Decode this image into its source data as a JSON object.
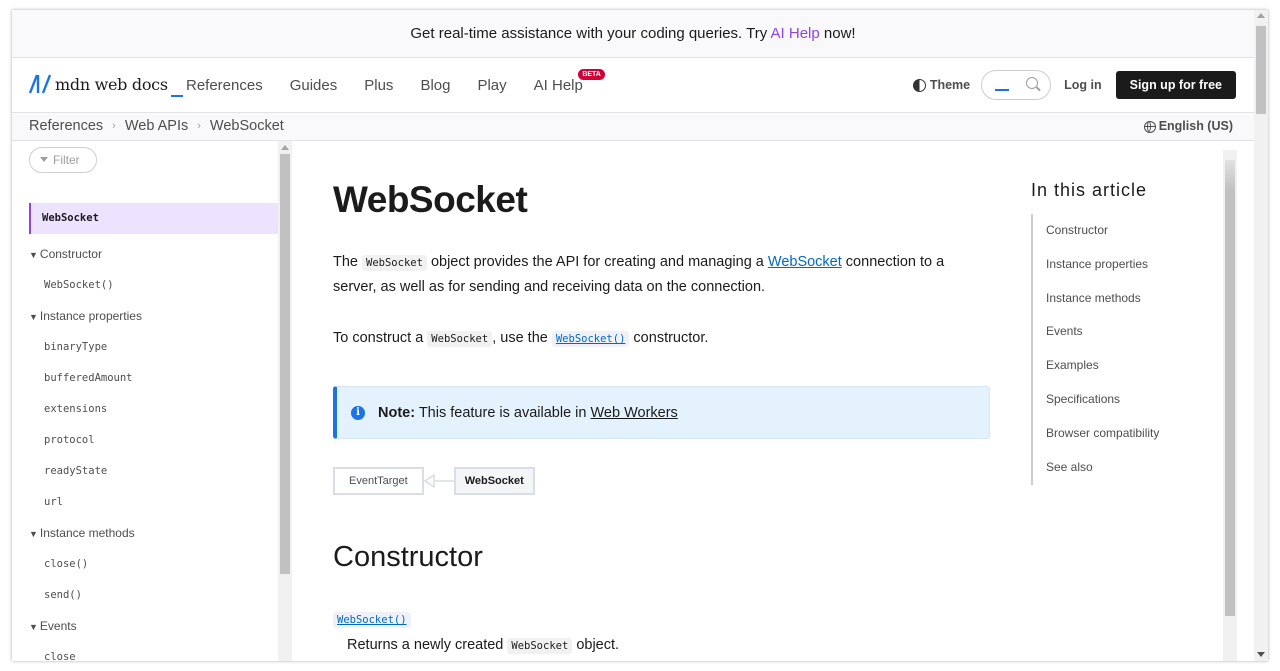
{
  "banner": {
    "prefix": "Get real-time assistance with your coding queries. Try ",
    "link": "AI Help",
    "suffix": " now!"
  },
  "header": {
    "logo_text": "mdn web docs",
    "nav": [
      {
        "label": "References"
      },
      {
        "label": "Guides"
      },
      {
        "label": "Plus"
      },
      {
        "label": "Blog"
      },
      {
        "label": "Play"
      },
      {
        "label": "AI Help",
        "badge": "BETA"
      }
    ],
    "theme_label": "Theme",
    "login_label": "Log in",
    "signup_label": "Sign up for free"
  },
  "breadcrumbs": [
    "References",
    "Web APIs",
    "WebSocket"
  ],
  "language": "English (US)",
  "sidebar": {
    "filter_placeholder": "Filter",
    "active": "WebSocket",
    "groups": [
      {
        "label": "Constructor",
        "items": [
          "WebSocket()"
        ]
      },
      {
        "label": "Instance properties",
        "items": [
          "binaryType",
          "bufferedAmount",
          "extensions",
          "protocol",
          "readyState",
          "url"
        ]
      },
      {
        "label": "Instance methods",
        "items": [
          "close()",
          "send()"
        ]
      },
      {
        "label": "Events",
        "items": [
          "close"
        ]
      }
    ]
  },
  "article": {
    "title": "WebSocket",
    "p1": {
      "t1": "The ",
      "code1": "WebSocket",
      "t2": " object provides the API for creating and managing a ",
      "link": "WebSocket",
      "t3": " connection to a server, as well as for sending and receiving data on the connection."
    },
    "p2": {
      "t1": "To construct a ",
      "code1": "WebSocket",
      "t2": ", use the ",
      "code_link": "WebSocket()",
      "t3": " constructor."
    },
    "note": {
      "label": "Note:",
      "text": " This feature is available in ",
      "link": "Web Workers"
    },
    "inheritance": [
      "EventTarget",
      "WebSocket"
    ],
    "section_constructor": {
      "heading": "Constructor",
      "link": "WebSocket()",
      "desc_t1": "Returns a newly created ",
      "desc_code": "WebSocket",
      "desc_t2": " object."
    }
  },
  "toc": {
    "title": "In this article",
    "items": [
      "Constructor",
      "Instance properties",
      "Instance methods",
      "Events",
      "Examples",
      "Specifications",
      "Browser compatibility",
      "See also"
    ]
  },
  "colors": {
    "accent_purple": "#8e44e3",
    "link_blue": "#0069c2",
    "note_blue": "#1a73e8",
    "beta_red": "#d30038"
  }
}
